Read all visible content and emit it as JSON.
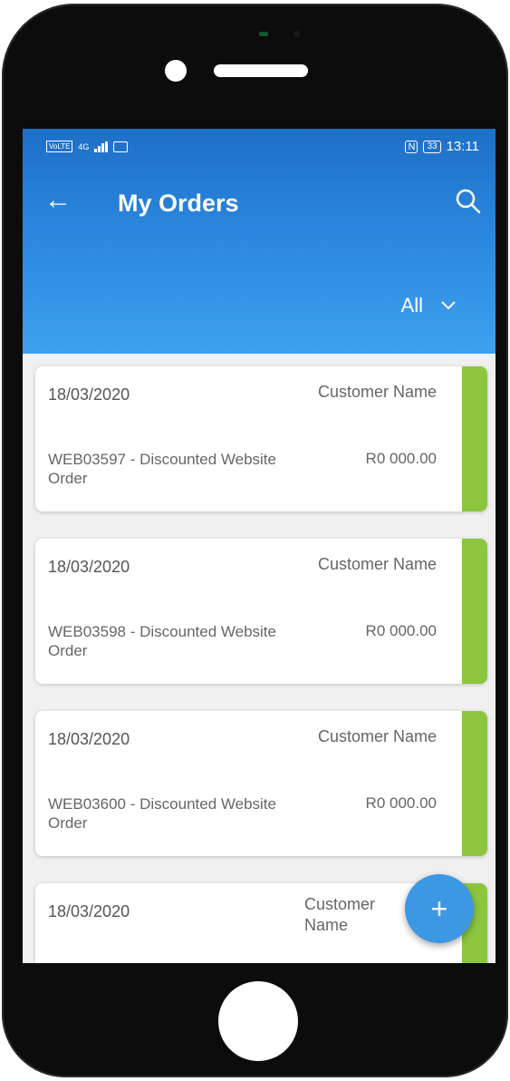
{
  "status_bar": {
    "network": "4G",
    "time": "13:11",
    "battery": "33",
    "volte": "VoLTE"
  },
  "header": {
    "title": "My Orders",
    "filter": "All"
  },
  "orders": [
    {
      "date": "18/03/2020",
      "customer": "Customer Name",
      "description": "WEB03597 - Discounted Website Order",
      "amount": "R0 000.00"
    },
    {
      "date": "18/03/2020",
      "customer": "Customer Name",
      "description": "WEB03598 - Discounted Website Order",
      "amount": "R0 000.00"
    },
    {
      "date": "18/03/2020",
      "customer": "Customer Name",
      "description": "WEB03600 - Discounted Website Order",
      "amount": "R0 000.00"
    },
    {
      "date": "18/03/2020",
      "customer": "Customer Name"
    }
  ],
  "fab_label": "+",
  "colors": {
    "accent": "#2a86dc",
    "status_green": "#8cc63f",
    "fab": "#3d98e3"
  }
}
